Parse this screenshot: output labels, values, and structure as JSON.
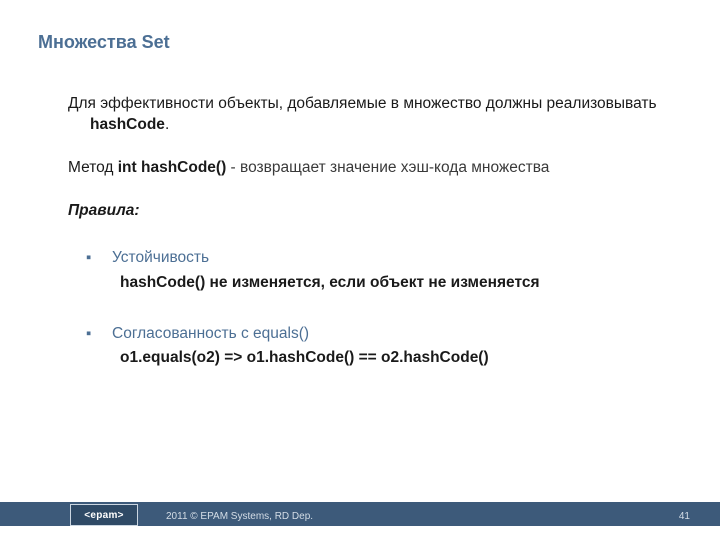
{
  "title": "Множества Set",
  "para1_pre": "Для эффективности объекты, добавляемые в множество должны реализовывать ",
  "para1_bold": "hashCode",
  "para1_post": ".",
  "para2_pre": "Метод ",
  "para2_bold": "int hashCode()",
  "para2_post": " - возвращает значение хэш-кода множества",
  "rules_label": "Правила:",
  "bullets": [
    {
      "title": "Устойчивость",
      "desc": "hashCode() не изменяется, если объект не изменяется"
    },
    {
      "title": "Согласованность с equals()",
      "desc": "o1.equals(o2) => o1.hashCode() == o2.hashCode()"
    }
  ],
  "footer": {
    "logo": "epam",
    "copyright": "2011 © EPAM Systems, RD Dep.",
    "page": "41"
  }
}
